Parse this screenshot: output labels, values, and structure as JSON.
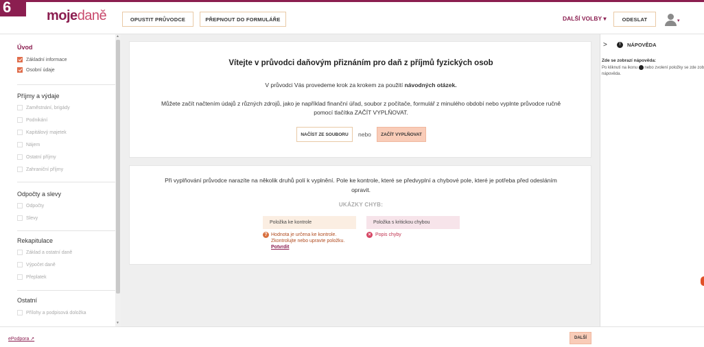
{
  "badge": "6",
  "logo": {
    "part1": "moje",
    "part2": "daně"
  },
  "header": {
    "exit_guide": "OPUSTIT PRŮVODCE",
    "switch_forms": "PŘEPNOUT DO FORMULÁŘE",
    "more_options": "DALŠÍ VOLBY ▾",
    "send": "ODESLAT",
    "avatar_caret": "▾"
  },
  "sidebar": {
    "sections": [
      {
        "title": "Úvod",
        "items": [
          "Základní informace",
          "Osobní údaje"
        ]
      },
      {
        "title": "Příjmy a výdaje",
        "items": [
          "Zaměstnání, brigády",
          "Podnikání",
          "Kapitálový majetek",
          "Nájem",
          "Ostatní příjmy",
          "Zahraniční příjmy"
        ]
      },
      {
        "title": "Odpočty a slevy",
        "items": [
          "Odpočty",
          "Slevy"
        ]
      },
      {
        "title": "Rekapitulace",
        "items": [
          "Základ a ostatní daně",
          "Výpočet daně",
          "Přeplatek"
        ]
      },
      {
        "title": "Ostatní",
        "items": [
          "Přílohy a podpisová doložka"
        ]
      }
    ]
  },
  "main": {
    "welcome_title": "Vítejte v průvodci daňovým přiznáním pro daň z příjmů fyzických osob",
    "welcome_sub_1": "V průvodci Vás provedeme krok za krokem za použití ",
    "welcome_sub_bold": "návodných otázek.",
    "welcome_desc": "Můžete začít načtením údajů z různých zdrojů, jako je například finanční úřad, soubor z počítače, formulář z minulého období nebo vyplnte průvodce ručně pomocí tlačítka ZAČÍT VYPLŇOVAT.",
    "load_file": "NAČÍST ZE SOUBORU",
    "or": "nebo",
    "start_filling": "ZAČÍT VYPLŇOVAT",
    "info_text": "Při vyplňování průvodce narazíte na několik druhů polí k vyplnění. Pole ke kontrole, které se předvyplní a chybové pole, které je potřeba před odesláním opravit.",
    "errors_heading": "UKÁZKY CHYB:",
    "field_check": "Položka ke kontrole",
    "field_error": "Položka s kritickou chybou",
    "check_msg": "Hodnota je určena ke kontrole. Zkontrolujte nebo upravte položku.",
    "confirm": "Potvrdit",
    "error_msg": "Popis chyby"
  },
  "help": {
    "title": "NÁPOVĚDA",
    "heading": "Zde se zobrazí nápověda:",
    "body_1": "Po kliknutí na ikonu",
    "body_2": "nebo zvolení položky se zde zobrazí nápověda."
  },
  "footer": {
    "epodpora": "ePodpora ↗",
    "next": "DALŠÍ"
  }
}
